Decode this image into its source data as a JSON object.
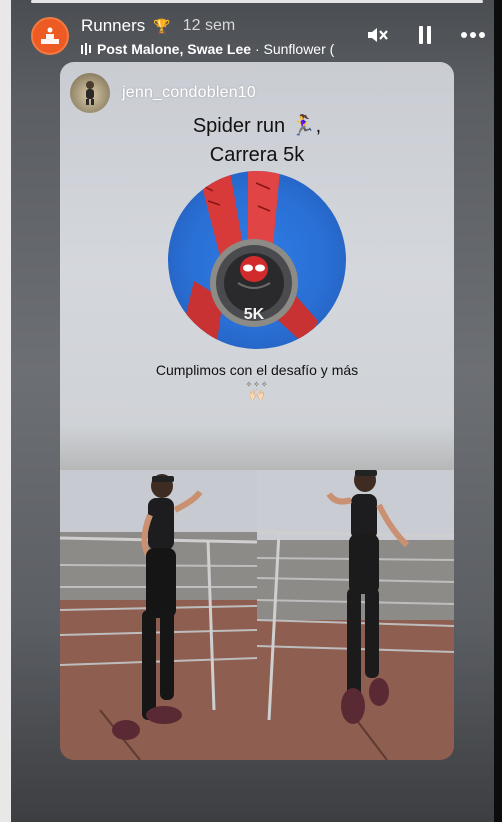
{
  "story": {
    "title": "Runners",
    "time": "12 sem",
    "song": {
      "artists": "Post Malone, Swae Lee",
      "track": " · Sunflower ("
    }
  },
  "post": {
    "username": "jenn_condoblen10",
    "headline_line1": "Spider run 🏃‍♀️,",
    "headline_line2": "Carrera 5k",
    "medal_text": "5K",
    "caption": "Cumplimos con el desafío y más",
    "caption_sub": "✧✧✧",
    "emoji": "🙌🏻"
  },
  "colors": {
    "accent": "#ee5a24",
    "medal_bg": "#2a6fd4",
    "ribbon": "#d83a3a"
  },
  "icons": [
    "trophy-icon",
    "mute-icon",
    "pause-icon",
    "more-icon",
    "music-bars-icon",
    "runner-avatar-icon"
  ]
}
